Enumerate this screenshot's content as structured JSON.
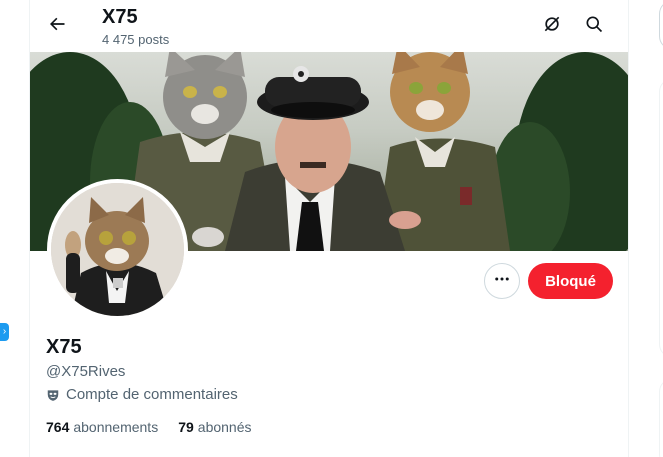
{
  "header": {
    "title": "X75",
    "posts_count": "4 475 posts",
    "back_icon": "arrow-left-icon",
    "hide_icon": "eye-slash-icon",
    "search_icon": "search-icon"
  },
  "profile": {
    "display_name": "X75",
    "handle": "@X75Rives",
    "label_icon": "mask-icon",
    "label": "Compte de commentaires",
    "following_count": "764",
    "following_label": "abonnements",
    "followers_count": "79",
    "followers_label": "abonnés"
  },
  "actions": {
    "more_icon": "more-dots-icon",
    "blocked_label": "Bloqué"
  },
  "colors": {
    "accent": "#1d9bf0",
    "blocked": "#f4212e",
    "text_primary": "#0f1419",
    "text_secondary": "#536471"
  }
}
